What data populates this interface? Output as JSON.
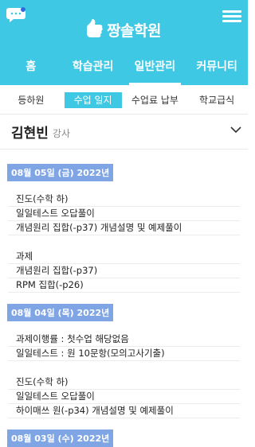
{
  "header": {
    "logo_text": "짱솔학원",
    "nav": [
      "홈",
      "학습관리",
      "일반관리",
      "커뮤니티"
    ],
    "nav_active": 2
  },
  "subnav": {
    "items": [
      "등하원",
      "수업 일지",
      "수업료 납부",
      "학교급식"
    ],
    "active": 1
  },
  "person": {
    "name": "김현빈",
    "role": "강사"
  },
  "entries": [
    {
      "date": "08월 05일 (금) 2022년",
      "blocks": [
        [
          "진도(수학 하)",
          "일일테스트 오답풀이",
          "개념원리 집합(-p37) 개념설명 및 예제풀이"
        ],
        [
          "과제",
          "개념원리 집합(-p37)",
          "RPM 집합(-p26)"
        ]
      ]
    },
    {
      "date": "08월 04일 (목) 2022년",
      "blocks": [
        [
          "과제이행률 : 첫수업 해당없음",
          "일일테스트 : 원 10문항(모의고사기출)"
        ],
        [
          "진도(수학 하)",
          "일일테스트 오답풀이",
          "하이매쓰 원(-p34) 개념설명 및 예제풀이"
        ]
      ]
    },
    {
      "date": "08월 03일 (수) 2022년",
      "blocks": []
    }
  ],
  "colors": {
    "primary": "#3ec8e4",
    "date_badge": "#7fa5e4",
    "notification_dot": "#2f6bd8"
  }
}
